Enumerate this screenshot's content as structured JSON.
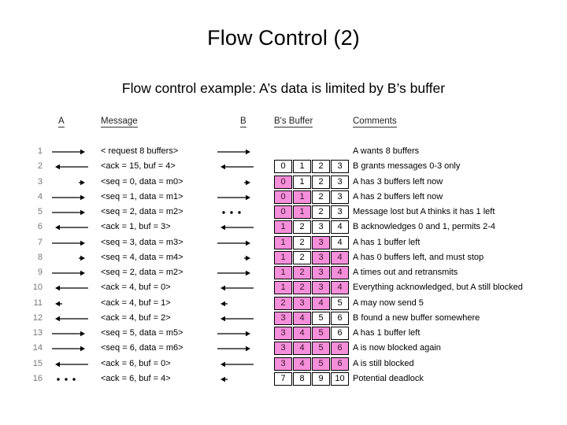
{
  "slide": {
    "title": "Flow Control (2)",
    "subtitle": "Flow control example: A’s data is limited by B’s buffer"
  },
  "colors": {
    "buffer_filled": "#f58fd9",
    "buffer_empty": "#ffffff",
    "row_number": "#777777",
    "text": "#000000"
  },
  "headers": {
    "a": "A",
    "message": "Message",
    "b": "B",
    "b_buffer": "B's Buffer",
    "comments": "Comments"
  },
  "rows": [
    {
      "num": "1",
      "a_arrow": "long-right",
      "message": "< request 8 buffers>",
      "b_arrow": "long-right",
      "buffer": null,
      "comment": "A wants 8 buffers"
    },
    {
      "num": "2",
      "a_arrow": "long-left",
      "message": "<ack = 15, buf = 4>",
      "b_arrow": "long-left",
      "buffer": {
        "values": [
          "0",
          "1",
          "2",
          "3"
        ],
        "filled": [
          false,
          false,
          false,
          false
        ]
      },
      "comment": "B grants messages 0-3 only"
    },
    {
      "num": "3",
      "a_arrow": "short-right",
      "message": "<seq = 0, data = m0>",
      "b_arrow": "short-right",
      "buffer": {
        "values": [
          "0",
          "1",
          "2",
          "3"
        ],
        "filled": [
          true,
          false,
          false,
          false
        ]
      },
      "comment": "A has 3 buffers left now"
    },
    {
      "num": "4",
      "a_arrow": "long-right",
      "message": "<seq = 1, data = m1>",
      "b_arrow": "long-right",
      "buffer": {
        "values": [
          "0",
          "1",
          "2",
          "3"
        ],
        "filled": [
          true,
          true,
          false,
          false
        ]
      },
      "comment": "A has 2 buffers left now"
    },
    {
      "num": "5",
      "a_arrow": "long-right",
      "message": "<seq = 2, data = m2>",
      "b_arrow": "dots",
      "buffer": {
        "values": [
          "0",
          "1",
          "2",
          "3"
        ],
        "filled": [
          true,
          true,
          false,
          false
        ]
      },
      "comment": "Message lost but A thinks it has 1 left"
    },
    {
      "num": "6",
      "a_arrow": "long-left",
      "message": "<ack = 1, buf = 3>",
      "b_arrow": "long-left",
      "buffer": {
        "values": [
          "1",
          "2",
          "3",
          "4"
        ],
        "filled": [
          true,
          false,
          false,
          false
        ]
      },
      "comment": "B acknowledges 0 and 1, permits 2-4"
    },
    {
      "num": "7",
      "a_arrow": "long-right",
      "message": "<seq = 3, data = m3>",
      "b_arrow": "long-right",
      "buffer": {
        "values": [
          "1",
          "2",
          "3",
          "4"
        ],
        "filled": [
          true,
          false,
          true,
          false
        ]
      },
      "comment": "A has 1 buffer left"
    },
    {
      "num": "8",
      "a_arrow": "short-right",
      "message": "<seq = 4, data = m4>",
      "b_arrow": "short-right",
      "buffer": {
        "values": [
          "1",
          "2",
          "3",
          "4"
        ],
        "filled": [
          true,
          false,
          true,
          true
        ]
      },
      "comment": "A has 0 buffers left, and must stop"
    },
    {
      "num": "9",
      "a_arrow": "long-right",
      "message": "<seq = 2, data = m2>",
      "b_arrow": "long-right",
      "buffer": {
        "values": [
          "1",
          "2",
          "3",
          "4"
        ],
        "filled": [
          true,
          true,
          true,
          true
        ]
      },
      "comment": "A times out and retransmits"
    },
    {
      "num": "10",
      "a_arrow": "long-left",
      "message": "<ack = 4, buf = 0>",
      "b_arrow": "long-left",
      "buffer": {
        "values": [
          "1",
          "2",
          "3",
          "4"
        ],
        "filled": [
          true,
          true,
          true,
          true
        ]
      },
      "comment": "Everything acknowledged, but A still blocked"
    },
    {
      "num": "11",
      "a_arrow": "short-left",
      "message": "<ack = 4, buf = 1>",
      "b_arrow": "short-left",
      "buffer": {
        "values": [
          "2",
          "3",
          "4",
          "5"
        ],
        "filled": [
          true,
          true,
          true,
          false
        ]
      },
      "comment": "A may now send 5"
    },
    {
      "num": "12",
      "a_arrow": "long-left",
      "message": "<ack = 4, buf = 2>",
      "b_arrow": "long-left",
      "buffer": {
        "values": [
          "3",
          "4",
          "5",
          "6"
        ],
        "filled": [
          true,
          true,
          false,
          false
        ]
      },
      "comment": "B found a new buffer somewhere"
    },
    {
      "num": "13",
      "a_arrow": "long-right",
      "message": "<seq = 5, data = m5>",
      "b_arrow": "long-right",
      "buffer": {
        "values": [
          "3",
          "4",
          "5",
          "6"
        ],
        "filled": [
          true,
          true,
          true,
          false
        ]
      },
      "comment": "A has 1 buffer left"
    },
    {
      "num": "14",
      "a_arrow": "long-right",
      "message": "<seq = 6, data = m6>",
      "b_arrow": "long-right",
      "buffer": {
        "values": [
          "3",
          "4",
          "5",
          "6"
        ],
        "filled": [
          true,
          true,
          true,
          true
        ]
      },
      "comment": "A is now blocked again"
    },
    {
      "num": "15",
      "a_arrow": "long-left",
      "message": "<ack = 6, buf = 0>",
      "b_arrow": "long-left",
      "buffer": {
        "values": [
          "3",
          "4",
          "5",
          "6"
        ],
        "filled": [
          true,
          true,
          true,
          true
        ]
      },
      "comment": "A is still blocked"
    },
    {
      "num": "16",
      "a_arrow": "dots",
      "message": "<ack = 6, buf = 4>",
      "b_arrow": "short-left",
      "buffer": {
        "values": [
          "7",
          "8",
          "9",
          "10"
        ],
        "filled": [
          false,
          false,
          false,
          false
        ]
      },
      "comment": "Potential deadlock"
    }
  ]
}
